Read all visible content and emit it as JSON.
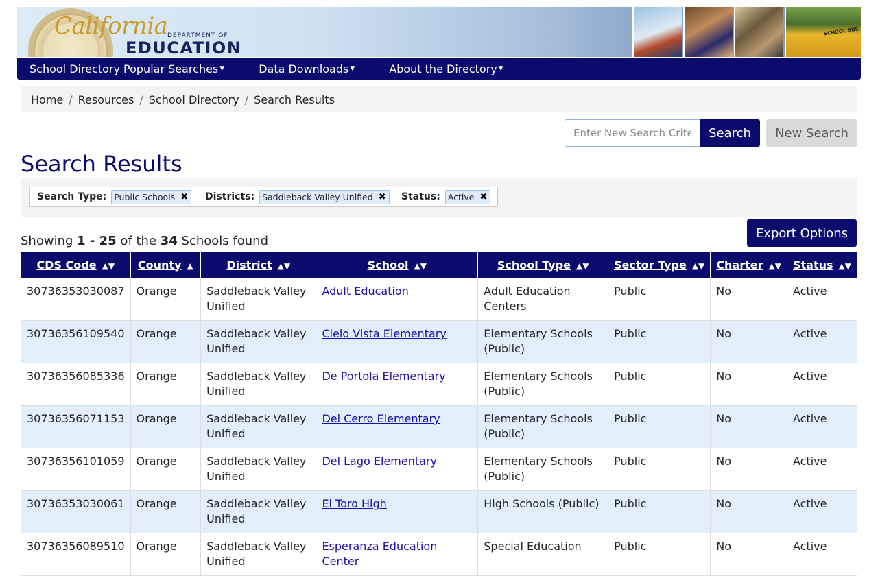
{
  "banner": {
    "logo_script": "California",
    "logo_dept": "DEPARTMENT OF",
    "logo_edu": "EDUCATION",
    "bus_text": "SCHOOL BUS"
  },
  "nav": {
    "items": [
      {
        "label": "School Directory Popular Searches",
        "icon": "caret-down-icon"
      },
      {
        "label": "Data Downloads",
        "icon": "caret-down-icon"
      },
      {
        "label": "About the Directory",
        "icon": "caret-down-icon"
      }
    ]
  },
  "breadcrumb": [
    "Home",
    "Resources",
    "School Directory",
    "Search Results"
  ],
  "search": {
    "placeholder": "Enter New Search Criter",
    "button_label": "Search",
    "new_search_label": "New Search"
  },
  "page_title": "Search Results",
  "filters": [
    {
      "label": "Search Type:",
      "value": "Public Schools"
    },
    {
      "label": "Districts:",
      "value": "Saddleback Valley Unified"
    },
    {
      "label": "Status:",
      "value": "Active"
    }
  ],
  "summary": {
    "prefix": "Showing ",
    "range": "1 - 25",
    "middle": " of the ",
    "total": "34",
    "suffix": " Schools found"
  },
  "export_label": "Export Options",
  "table": {
    "headers": [
      {
        "label": "CDS Code",
        "sort": "both"
      },
      {
        "label": "County",
        "sort": "asc"
      },
      {
        "label": "District",
        "sort": "both"
      },
      {
        "label": "School",
        "sort": "both"
      },
      {
        "label": "School Type",
        "sort": "both"
      },
      {
        "label": "Sector Type",
        "sort": "both"
      },
      {
        "label": "Charter",
        "sort": "both"
      },
      {
        "label": "Status",
        "sort": "both"
      }
    ],
    "rows": [
      [
        "30736353030087",
        "Orange",
        "Saddleback Valley Unified",
        "Adult Education",
        "Adult Education Centers",
        "Public",
        "No",
        "Active"
      ],
      [
        "30736356109540",
        "Orange",
        "Saddleback Valley Unified",
        "Cielo Vista Elementary",
        "Elementary Schools (Public)",
        "Public",
        "No",
        "Active"
      ],
      [
        "30736356085336",
        "Orange",
        "Saddleback Valley Unified",
        "De Portola Elementary",
        "Elementary Schools (Public)",
        "Public",
        "No",
        "Active"
      ],
      [
        "30736356071153",
        "Orange",
        "Saddleback Valley Unified",
        "Del Cerro Elementary",
        "Elementary Schools (Public)",
        "Public",
        "No",
        "Active"
      ],
      [
        "30736356101059",
        "Orange",
        "Saddleback Valley Unified",
        "Del Lago Elementary",
        "Elementary Schools (Public)",
        "Public",
        "No",
        "Active"
      ],
      [
        "30736353030061",
        "Orange",
        "Saddleback Valley Unified",
        "El Toro High",
        "High Schools (Public)",
        "Public",
        "No",
        "Active"
      ],
      [
        "30736356089510",
        "Orange",
        "Saddleback Valley Unified",
        "Esperanza Education Center",
        "Special Education",
        "Public",
        "No",
        "Active"
      ]
    ]
  }
}
